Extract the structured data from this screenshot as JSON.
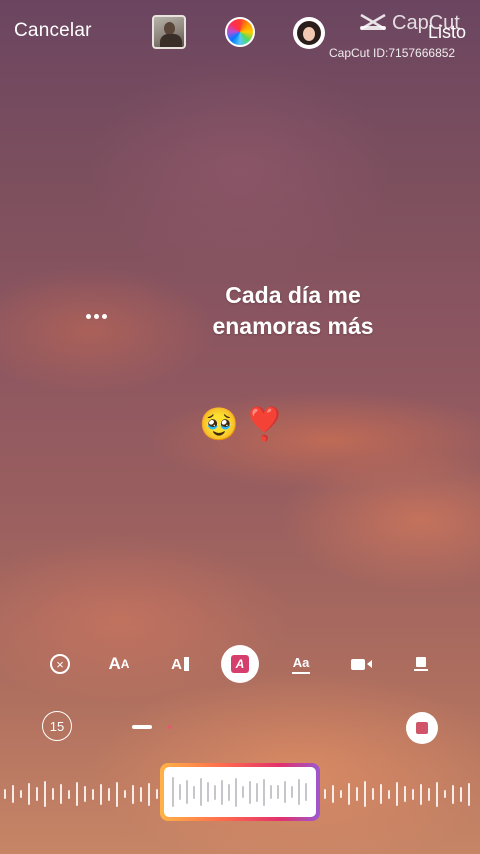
{
  "header": {
    "cancel_label": "Cancelar",
    "done_label": "Listo",
    "watermark_brand": "CapCut",
    "watermark_id": "CapCut ID:7157666852"
  },
  "canvas": {
    "caption_line1": "Cada día me",
    "caption_line2": "enamoras más",
    "emoji_1": "🥹",
    "emoji_2": "❣️"
  },
  "toolbar": {
    "close_icon": "x-circle-icon",
    "aa_label_big": "A",
    "aa_label_small": "A",
    "align_label": "A",
    "selected_label": "A",
    "aa2_label": "Aa"
  },
  "controls": {
    "duration_label": "15"
  },
  "colors": {
    "accent": "#d43f6e",
    "stop": "#d0556b"
  }
}
